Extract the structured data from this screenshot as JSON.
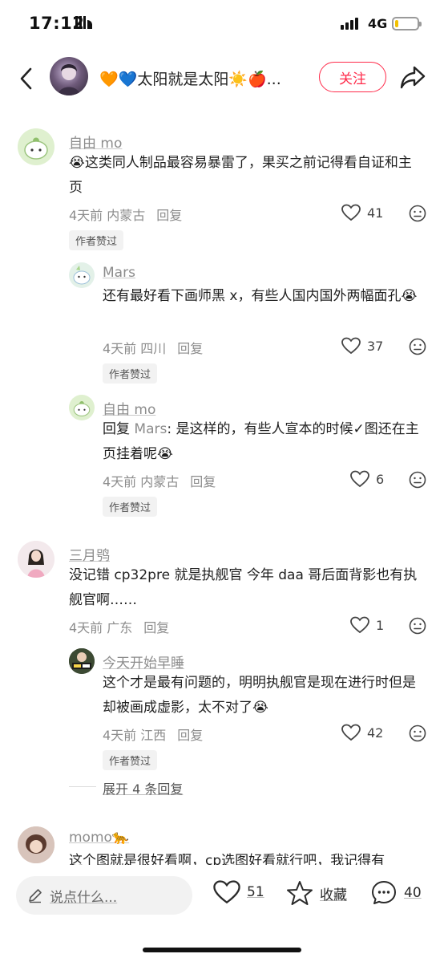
{
  "status_bar": {
    "time": "17:12",
    "network": "4G",
    "battery_level": 0.15
  },
  "header": {
    "author_name": "🧡💙太阳就是太阳☀️🍎...",
    "follow_label": "关注"
  },
  "comments": [
    {
      "name": "自由 mo",
      "text": "😭这类同人制品最容易暴雷了，果买之前记得看自证和主页",
      "time_location": "4天前 内蒙古",
      "reply_label": "回复",
      "likes": "41",
      "tag": "作者赞过",
      "replies": [
        {
          "name": "Mars",
          "text": "还有最好看下画师黑 x，有些人国内国外两幅面孔😭",
          "time_location": "4天前 四川",
          "reply_label": "回复",
          "likes": "37",
          "tag": "作者赞过"
        },
        {
          "name": "自由 mo",
          "reply_prefix": "回复 ",
          "reply_target": "Mars",
          "text": ": 是这样的，有些人宣本的时候✓图还在主页挂着呢😭",
          "time_location": "4天前 内蒙古",
          "reply_label": "回复",
          "likes": "6",
          "tag": "作者赞过"
        }
      ]
    },
    {
      "name": "三月鸮",
      "text": "没记错 cp32pre 就是执舰官 今年 daa 哥后面背影也有执舰官啊……",
      "time_location": "4天前 广东",
      "reply_label": "回复",
      "likes": "1",
      "replies": [
        {
          "name": "今天开始早睡",
          "text": "这个才是最有问题的，明明执舰官是现在进行时但是却被画成虚影，太不对了😭",
          "time_location": "4天前 江西",
          "reply_label": "回复",
          "likes": "42",
          "tag": "作者赞过"
        }
      ],
      "expand_label": "展开 4 条回复"
    },
    {
      "name": "momo🐆",
      "text": "这个图就是很好看啊，cp选图好看就行吧，我记得有"
    }
  ],
  "bottom_bar": {
    "reply_placeholder": "说点什么...",
    "likes": "51",
    "collect_label": "收藏",
    "comments_count": "40"
  },
  "colors": {
    "accent": "#ff2b4a",
    "muted_text": "#8c8c8c",
    "tag_bg": "#f2f2f2"
  }
}
